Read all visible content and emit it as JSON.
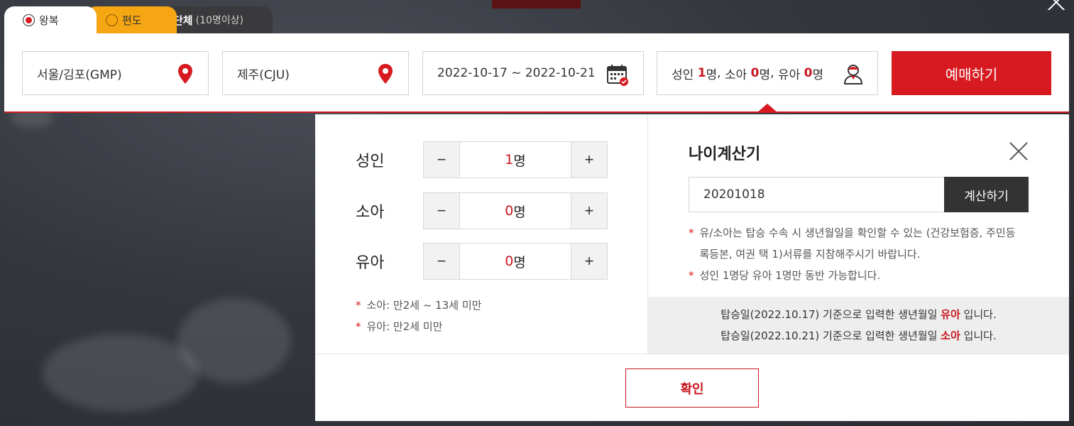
{
  "tabs": [
    {
      "label": "왕복",
      "selected": true
    },
    {
      "label": "편도",
      "selected": false
    },
    {
      "label": "단체",
      "sub": "(10명이상)"
    }
  ],
  "search": {
    "origin": "서울/김포(GMP)",
    "destination": "제주(CJU)",
    "dates": "2022-10-17 ~ 2022-10-21",
    "pax": {
      "adult_label": "성인",
      "adult": "1",
      "child_label": "소아",
      "child": "0",
      "infant_label": "유아",
      "infant": "0",
      "unit": "명"
    },
    "reserve_label": "예매하기"
  },
  "passengers": [
    {
      "label": "성인",
      "value": "1",
      "unit": "명"
    },
    {
      "label": "소아",
      "value": "0",
      "unit": "명"
    },
    {
      "label": "유아",
      "value": "0",
      "unit": "명"
    }
  ],
  "stepper": {
    "minus": "−",
    "plus": "+"
  },
  "notes_left": [
    "소아: 만2세 ~ 13세 미만",
    "유아: 만2세 미만"
  ],
  "age_calc": {
    "title": "나이계산기",
    "input_value": "20201018",
    "button": "계산하기",
    "notes": [
      "유/소아는 탑승 수속 시 생년월일을 확인할 수 있는 (건강보험증, 주민등록등본, 여권 택 1)서류를 지참해주시기 바랍니다.",
      "성인 1명당 유아 1명만 동반 가능합니다."
    ],
    "results": [
      {
        "prefix": "탑승일(2022.10.17) 기준으로 입력한 생년월일",
        "type": "유아",
        "suffix": "입니다."
      },
      {
        "prefix": "탑승일(2022.10.21) 기준으로 입력한 생년월일",
        "type": "소아",
        "suffix": "입니다."
      }
    ]
  },
  "confirm_label": "확인",
  "colors": {
    "brand_red": "#d71920",
    "tab_orange": "#f5a612",
    "tab_dark": "#3a3a3c"
  }
}
